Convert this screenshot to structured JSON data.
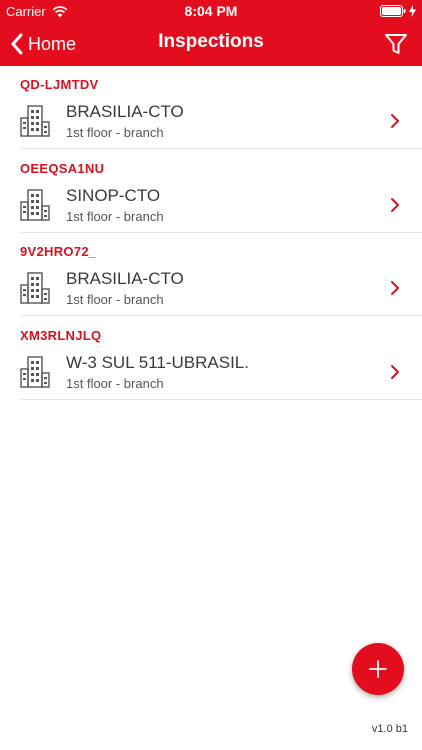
{
  "status_bar": {
    "carrier": "Carrier",
    "time": "8:04 PM"
  },
  "nav": {
    "back_label": "Home",
    "title": "Inspections"
  },
  "items": [
    {
      "code": "QD-LJMTDV",
      "name": "BRASILIA-CTO",
      "subtitle": "1st floor - branch"
    },
    {
      "code": "OEEQSA1NU",
      "name": "SINOP-CTO",
      "subtitle": "1st floor - branch"
    },
    {
      "code": "9V2HRO72_",
      "name": "BRASILIA-CTO",
      "subtitle": "1st floor - branch"
    },
    {
      "code": "XM3RLNJLQ",
      "name": "W-3 SUL 511-UBRASIL.",
      "subtitle": "1st floor - branch"
    }
  ],
  "version": "v1.0 b1",
  "colors": {
    "brand_red": "#e30d1d",
    "code_red": "#d81020",
    "text_dark": "#3a3a3a"
  },
  "icons": {
    "back": "chevron-left-icon",
    "filter": "filter-icon",
    "building": "building-icon",
    "row_chevron": "chevron-right-icon",
    "add": "plus-icon",
    "wifi": "wifi-icon",
    "battery": "battery-icon"
  }
}
